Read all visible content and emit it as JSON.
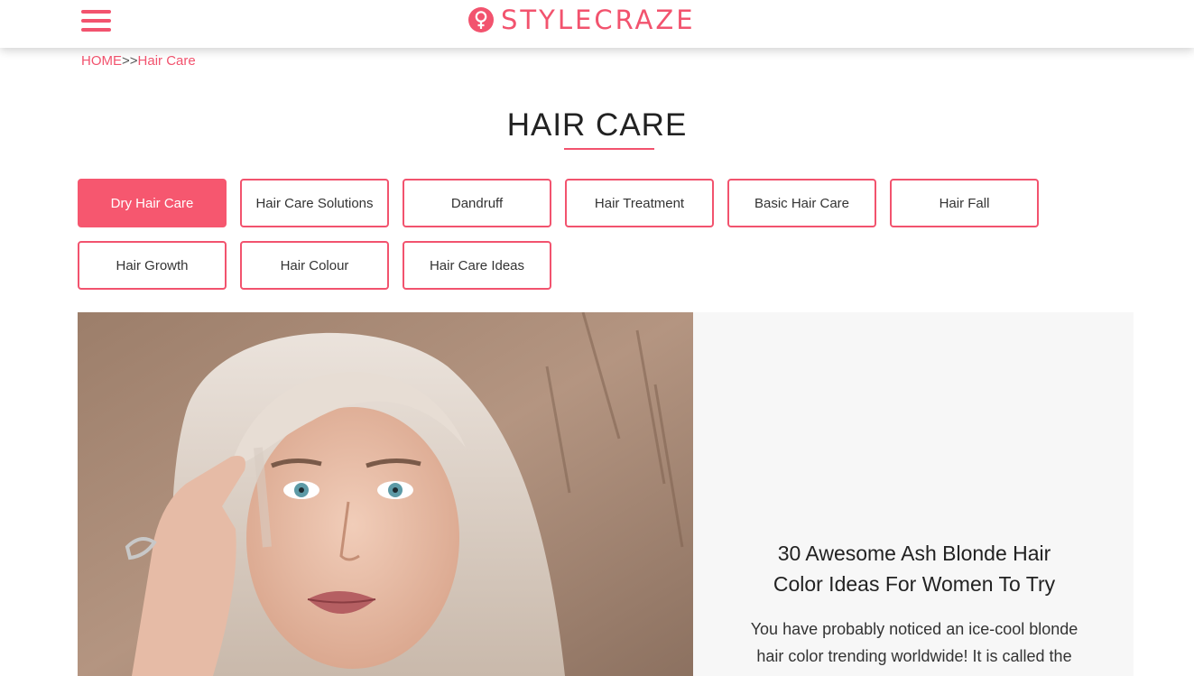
{
  "header": {
    "menu_icon": "hamburger-menu-icon",
    "logo_icon": "female-symbol-icon",
    "logo_text": "STYLECRAZE",
    "accent_color": "#f2536e"
  },
  "breadcrumb": {
    "home": "HOME",
    "separator": ">>",
    "current": "Hair Care"
  },
  "page": {
    "title": "HAIR CARE"
  },
  "categories": [
    {
      "label": "Dry Hair Care",
      "active": true
    },
    {
      "label": "Hair Care Solutions",
      "active": false
    },
    {
      "label": "Dandruff",
      "active": false
    },
    {
      "label": "Hair Treatment",
      "active": false
    },
    {
      "label": "Basic Hair Care",
      "active": false
    },
    {
      "label": "Hair Fall",
      "active": false
    },
    {
      "label": "Hair Growth",
      "active": false
    },
    {
      "label": "Hair Colour",
      "active": false
    },
    {
      "label": "Hair Care Ideas",
      "active": false
    }
  ],
  "featured": {
    "title_line1": "30 Awesome Ash Blonde Hair",
    "title_line2": "Color Ideas For Women To Try",
    "excerpt_line1": "You have probably noticed an ice-cool blonde",
    "excerpt_line2": "hair color trending worldwide! It is called the"
  }
}
